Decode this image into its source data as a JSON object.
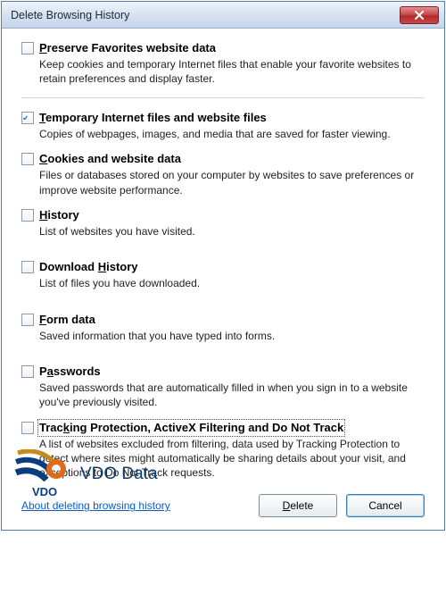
{
  "title": "Delete Browsing History",
  "options": {
    "preserve": {
      "label_pre": "",
      "accel": "P",
      "label_post": "reserve Favorites website data",
      "desc": "Keep cookies and temporary Internet files that enable your favorite websites to retain preferences and display faster.",
      "checked": false
    },
    "tempfiles": {
      "label_pre": "",
      "accel": "T",
      "label_post": "emporary Internet files and website files",
      "desc": "Copies of webpages, images, and media that are saved for faster viewing.",
      "checked": true
    },
    "cookies": {
      "label_pre": "",
      "accel": "C",
      "label_post": "ookies and website data",
      "desc": "Files or databases stored on your computer by websites to save preferences or improve website performance.",
      "checked": false
    },
    "history": {
      "label_pre": "",
      "accel": "H",
      "label_post": "istory",
      "desc": "List of websites you have visited.",
      "checked": false
    },
    "download": {
      "label_pre": "Download ",
      "accel": "H",
      "label_post": "istory",
      "desc": "List of files you have downloaded.",
      "checked": false
    },
    "formdata": {
      "label_pre": "",
      "accel": "F",
      "label_post": "orm data",
      "desc": "Saved information that you have typed into forms.",
      "checked": false
    },
    "passwords": {
      "label_pre": "P",
      "accel": "a",
      "label_post": "sswords",
      "desc": "Saved passwords that are automatically filled in when you sign in to a website you've previously visited.",
      "checked": false
    },
    "tracking": {
      "label_pre": "Trac",
      "accel": "k",
      "label_post": "ing Protection, ActiveX Filtering and Do Not Track",
      "desc": "A list of websites excluded from filtering, data used by Tracking Protection to detect where sites might automatically be sharing details about your visit, and exceptions to Do Not Track requests.",
      "checked": false
    }
  },
  "link": "About deleting browsing history",
  "buttons": {
    "delete_pre": "",
    "delete_accel": "D",
    "delete_post": "elete",
    "cancel": "Cancel"
  },
  "watermark": "VDO Data"
}
